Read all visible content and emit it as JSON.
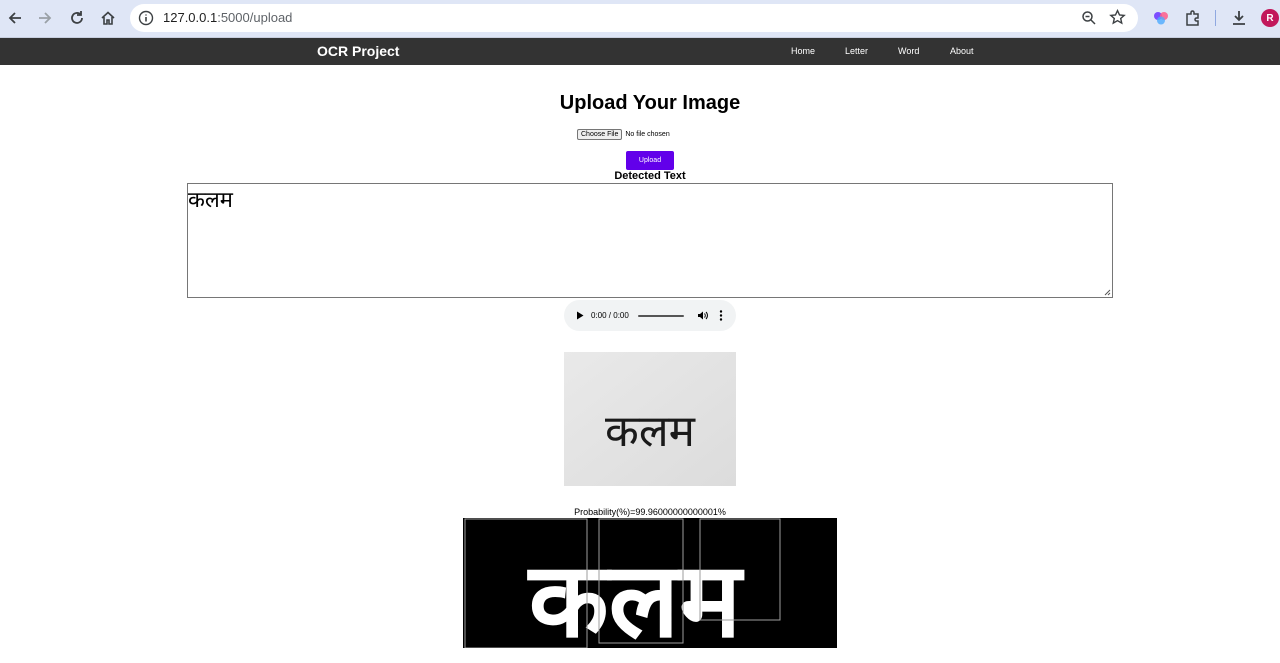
{
  "browser": {
    "url_host": "127.0.0.1",
    "url_path": ":5000/upload",
    "avatar_letter": "R"
  },
  "navbar": {
    "brand": "OCR Project",
    "links": [
      "Home",
      "Letter",
      "Word",
      "About"
    ]
  },
  "main": {
    "title": "Upload Your Image",
    "choose_file_label": "Choose File",
    "file_status": "No file chosen",
    "upload_label": "Upload",
    "detected_label": "Detected Text",
    "detected_text": "कलम",
    "audio_time": "0:00 / 0:00",
    "uploaded_image_text": "कलम",
    "segmented_image_text": "कलम",
    "probability": "Probability(%)=99.96000000000001%"
  },
  "colors": {
    "navbar_bg": "#333333",
    "upload_button": "#6200ea",
    "chrome_bg": "#dfe6f6"
  }
}
